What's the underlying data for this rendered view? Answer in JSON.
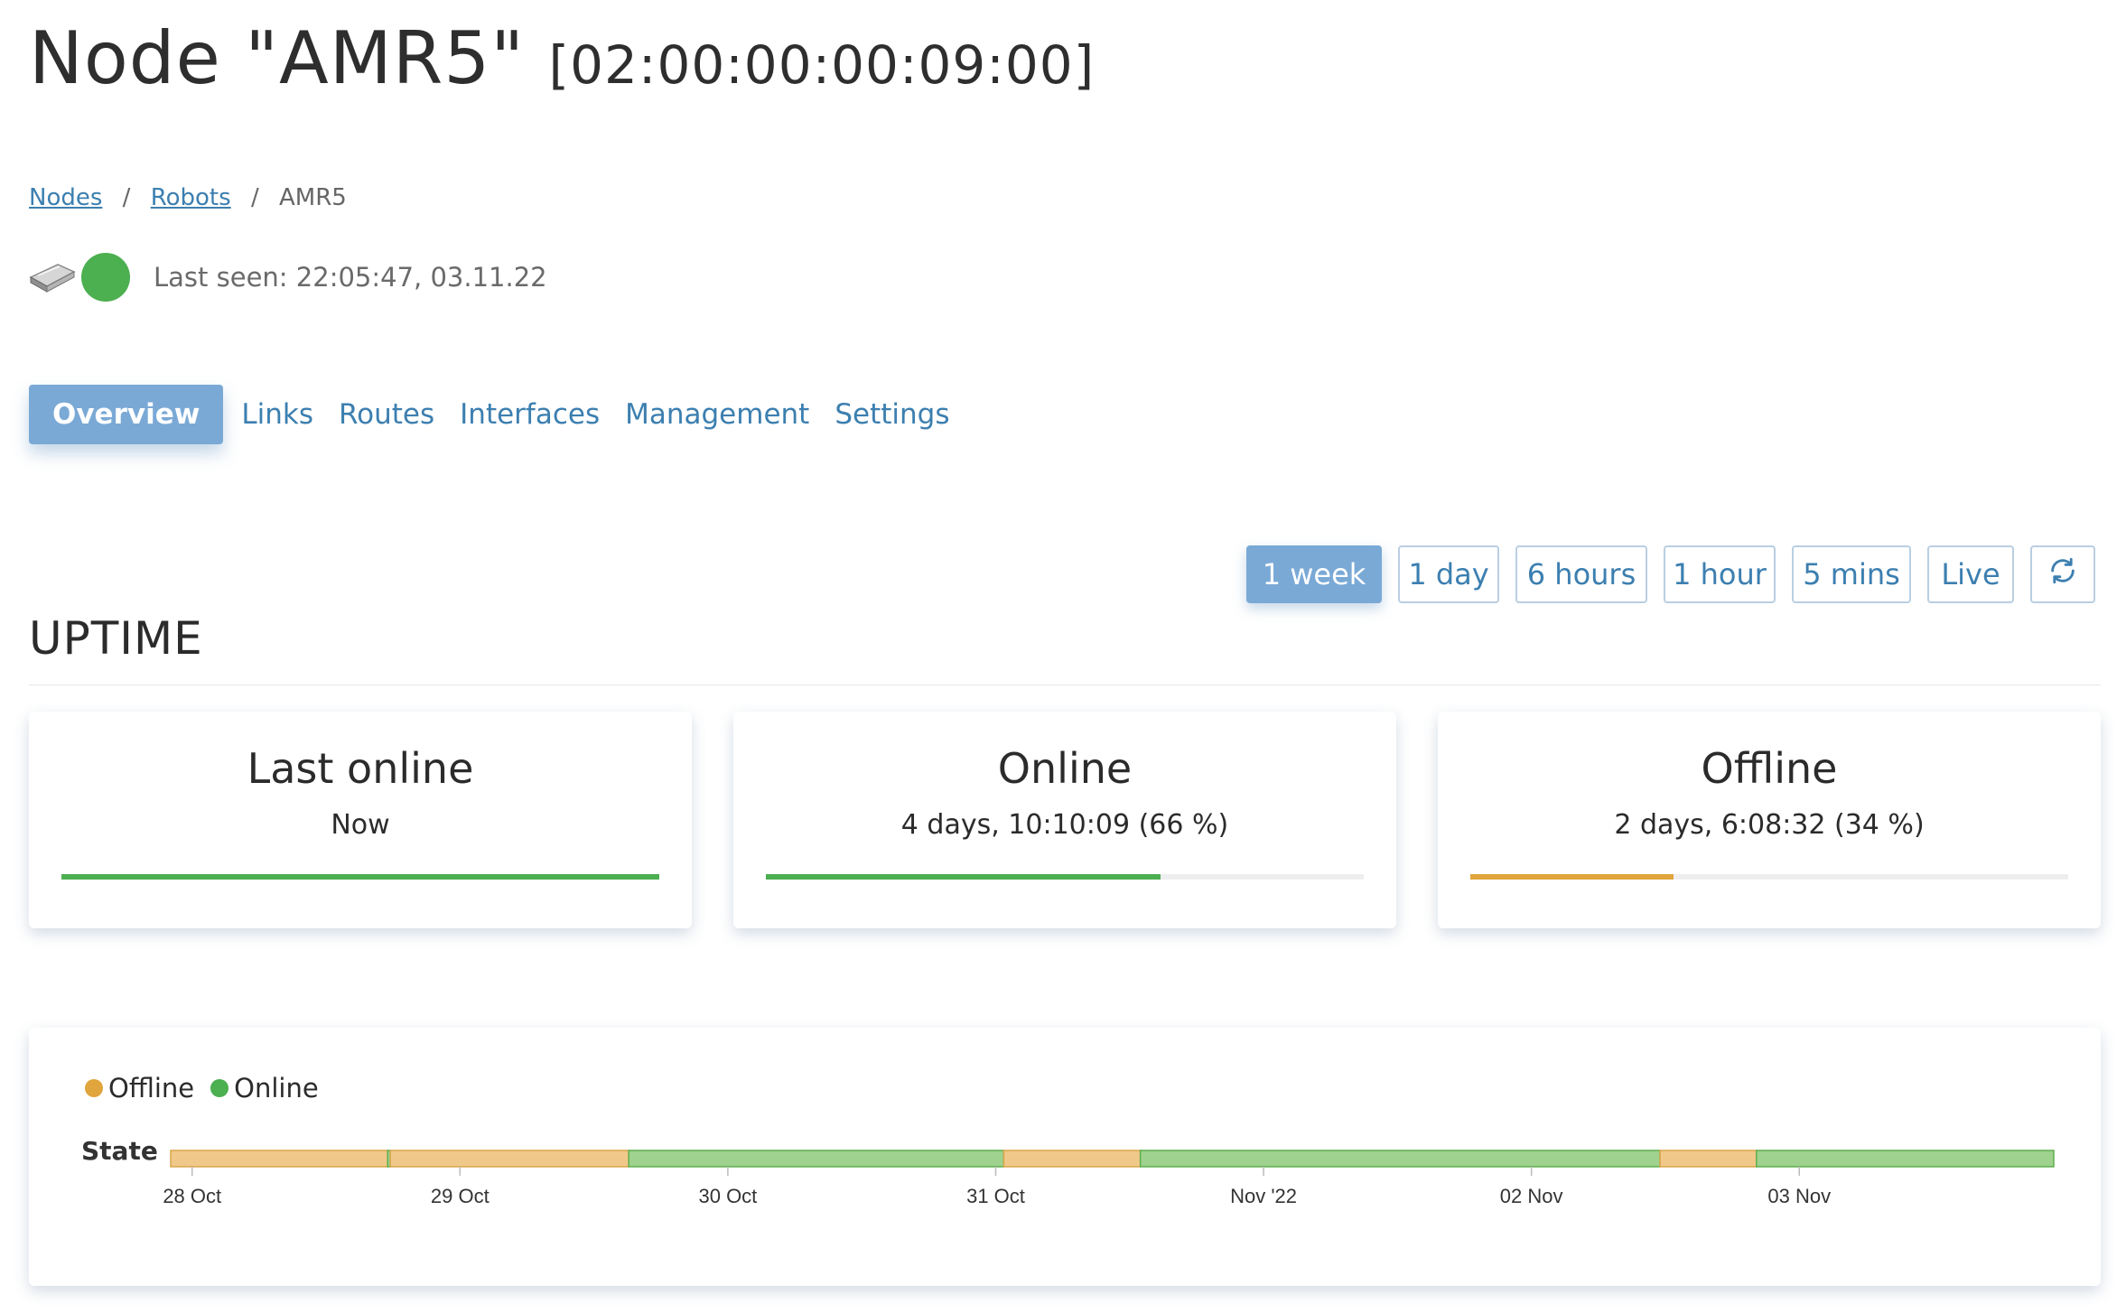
{
  "header": {
    "title": "Node \"AMR5\"",
    "mac": "[02:00:00:00:09:00]"
  },
  "breadcrumb": {
    "items": [
      {
        "label": "Nodes"
      },
      {
        "label": "Robots"
      },
      {
        "label": "AMR5"
      }
    ],
    "separator": "/"
  },
  "status": {
    "device_icon": "robot-device-icon",
    "state_color": "#4caf50",
    "last_seen": "Last seen: 22:05:47, 03.11.22"
  },
  "tabs": [
    {
      "label": "Overview",
      "active": true
    },
    {
      "label": "Links"
    },
    {
      "label": "Routes"
    },
    {
      "label": "Interfaces"
    },
    {
      "label": "Management"
    },
    {
      "label": "Settings"
    }
  ],
  "time_range": {
    "options": [
      {
        "label": "1 week",
        "active": true
      },
      {
        "label": "1 day"
      },
      {
        "label": "6 hours"
      },
      {
        "label": "1 hour"
      },
      {
        "label": "5 mins"
      },
      {
        "label": "Live"
      }
    ],
    "refresh_icon": "refresh-icon"
  },
  "uptime": {
    "heading": "UPTIME",
    "cards": [
      {
        "title": "Last online",
        "value": "Now",
        "fraction": 1.0,
        "color": "#4caf50"
      },
      {
        "title": "Online",
        "value": "4 days, 10:10:09 (66 %)",
        "fraction": 0.66,
        "color": "#4caf50"
      },
      {
        "title": "Offline",
        "value": "2 days, 6:08:32 (34 %)",
        "fraction": 0.34,
        "color": "#e0a53c"
      }
    ]
  },
  "colors": {
    "accent": "#7aa9d6",
    "link": "#3c7fb0",
    "online": "#4caf50",
    "offline": "#e0a53c"
  },
  "chart_data": {
    "type": "timeline",
    "legend": [
      {
        "name": "Offline",
        "color": "#e0a53c"
      },
      {
        "name": "Online",
        "color": "#4caf50"
      }
    ],
    "row_label": "State",
    "x_ticks": [
      "28 Oct",
      "29 Oct",
      "30 Oct",
      "31 Oct",
      "Nov '22",
      "02 Nov",
      "03 Nov"
    ],
    "x_range_days": [
      -0.08,
      6.95
    ],
    "segments": [
      {
        "state": "Offline",
        "start": -0.08,
        "end": 0.73
      },
      {
        "state": "Online",
        "start": 0.73,
        "end": 0.74
      },
      {
        "state": "Offline",
        "start": 0.74,
        "end": 1.63
      },
      {
        "state": "Online",
        "start": 1.63,
        "end": 3.03
      },
      {
        "state": "Offline",
        "start": 3.03,
        "end": 3.54
      },
      {
        "state": "Online",
        "start": 3.54,
        "end": 5.48
      },
      {
        "state": "Offline",
        "start": 5.48,
        "end": 5.84
      },
      {
        "state": "Online",
        "start": 5.84,
        "end": 6.95
      }
    ]
  }
}
